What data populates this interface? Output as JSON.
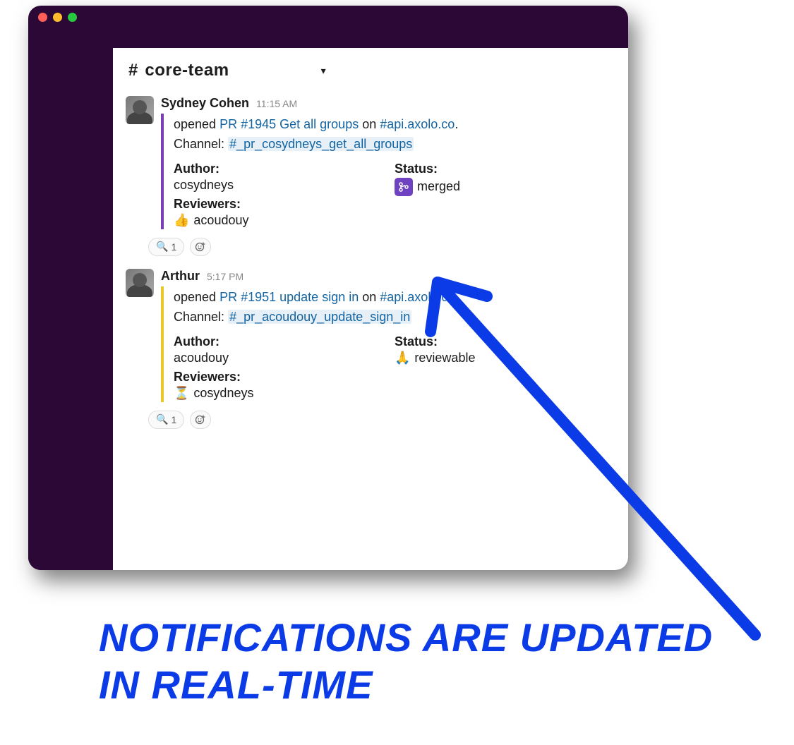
{
  "channel": {
    "hash": "#",
    "name": "core-team"
  },
  "messages": [
    {
      "author": "Sydney Cohen",
      "time": "11:15 AM",
      "bar_color": "purple",
      "opened_prefix": "opened ",
      "pr_link": "PR #1945 Get all groups",
      "on_text": " on ",
      "repo_link": "#api.axolo.co",
      "period": ".",
      "channel_label": "Channel: ",
      "channel_link": "#_pr_cosydneys_get_all_groups",
      "author_label": "Author:",
      "author_value": "cosydneys",
      "reviewers_label": "Reviewers:",
      "reviewer_emoji": "👍",
      "reviewer_value": "acoudouy",
      "status_label": "Status:",
      "status_icon": "merge",
      "status_value": "merged",
      "reaction_emoji": "🔍",
      "reaction_count": "1"
    },
    {
      "author": "Arthur",
      "time": "5:17 PM",
      "bar_color": "yellow",
      "opened_prefix": "opened ",
      "pr_link": "PR #1951 update sign in",
      "on_text": " on ",
      "repo_link": "#api.axolo.co",
      "period": ".",
      "channel_label": "Channel: ",
      "channel_link": "#_pr_acoudouy_update_sign_in",
      "author_label": "Author:",
      "author_value": "acoudouy",
      "reviewers_label": "Reviewers:",
      "reviewer_emoji": "⏳",
      "reviewer_value": "cosydneys",
      "status_label": "Status:",
      "status_icon": "pray",
      "status_value": "reviewable",
      "reaction_emoji": "🔍",
      "reaction_count": "1"
    }
  ],
  "caption": "NOTIFICATIONS ARE UPDATED IN REAL-TIME",
  "colors": {
    "accent_blue": "#0b3be6",
    "slack_purple": "#2b0836",
    "link": "#1264a3"
  }
}
